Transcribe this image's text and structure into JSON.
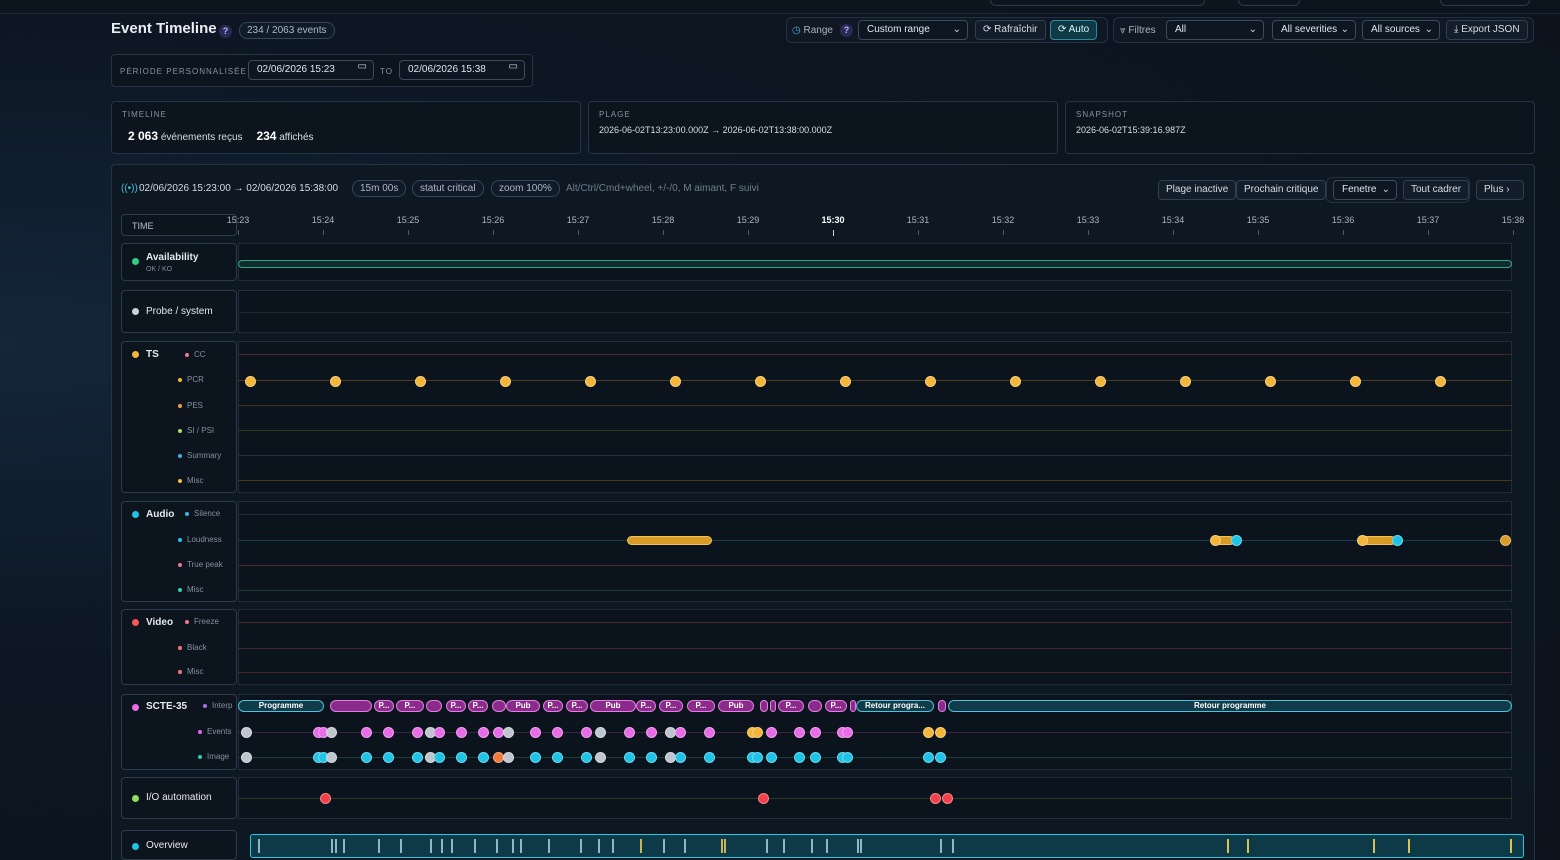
{
  "header": {
    "title": "Event Timeline",
    "help": "?",
    "count_chip": "234 / 2063 events"
  },
  "controls": {
    "range_label": "Range",
    "range_help": "?",
    "range_value": "Custom range",
    "refresh_label": "Rafraîchir",
    "auto_label": "Auto",
    "filters_label": "Filtres",
    "filter_type": "All",
    "severities": "All severities",
    "sources": "All sources",
    "export_label": "Export JSON"
  },
  "period": {
    "label": "PÉRIODE PERSONNALISÉE",
    "from": "02/06/2026 15:23",
    "to_label": "TO",
    "to": "02/06/2026 15:38"
  },
  "stats": {
    "timeline_header": "TIMELINE",
    "received_count": "2 063",
    "received_label": "événements reçus",
    "shown_count": "234",
    "shown_label": "affichés",
    "plage_header": "PLAGE",
    "plage_value": "2026-06-02T13:23:00.000Z → 2026-06-02T13:38:00.000Z",
    "snapshot_header": "SNAPSHOT",
    "snapshot_value": "2026-06-02T15:39:16.987Z"
  },
  "toolbar": {
    "live_icon": "broadcast-icon",
    "range_text": "02/06/2026 15:23:00 → 02/06/2026 15:38:00",
    "duration_chip": "15m 00s",
    "status_chip": "statut critical",
    "zoom_chip": "zoom 100%",
    "hint": "Alt/Ctrl/Cmd+wheel, +/-/0, M aimant, F suivi",
    "inactive_btn": "Plage inactive",
    "next_critical_btn": "Prochain critique",
    "window_select": "Fenetre",
    "fit_btn": "Tout cadrer",
    "more_btn": "Plus"
  },
  "axis": {
    "time_label": "TIME",
    "ticks": [
      "15:23",
      "15:24",
      "15:25",
      "15:26",
      "15:27",
      "15:28",
      "15:29",
      "15:30",
      "15:31",
      "15:32",
      "15:33",
      "15:34",
      "15:35",
      "15:36",
      "15:37",
      "15:38"
    ],
    "bold_tick": "15:30"
  },
  "tracks": {
    "availability": {
      "name": "Availability",
      "sub": "OK / KO",
      "color": "#2fd083"
    },
    "probe": {
      "name": "Probe / system",
      "color": "#c9d1da"
    },
    "ts": {
      "name": "TS",
      "color": "#f4b63a",
      "subs": [
        "CC",
        "PCR",
        "PES",
        "SI / PSI",
        "Summary",
        "Misc"
      ]
    },
    "audio": {
      "name": "Audio",
      "color": "#1fc3e6",
      "subs": [
        "Silence",
        "Loudness",
        "True peak",
        "Misc"
      ]
    },
    "video": {
      "name": "Video",
      "color": "#f2575d",
      "subs": [
        "Freeze",
        "Black",
        "Misc"
      ]
    },
    "scte": {
      "name": "SCTE-35",
      "color": "#e86be8",
      "subs": [
        "Interp",
        "Events",
        "Image"
      ]
    },
    "io": {
      "name": "I/O automation",
      "color": "#8fe05a"
    },
    "overview": {
      "name": "Overview",
      "color": "#1fc3e6"
    }
  },
  "scte_segments": [
    {
      "label": "Programme",
      "kind": "prog"
    },
    {
      "label": "Pub",
      "kind": "pub"
    },
    {
      "label": "P...",
      "kind": "pub"
    },
    {
      "label": "Pub",
      "kind": "pub"
    },
    {
      "label": "Pub",
      "kind": "pub"
    },
    {
      "label": "P...",
      "kind": "pub"
    },
    {
      "label": "P...",
      "kind": "pub"
    },
    {
      "label": "Pub",
      "kind": "pub"
    },
    {
      "label": "P...",
      "kind": "pub"
    },
    {
      "label": "P...",
      "kind": "pub"
    },
    {
      "label": "Retour progra...",
      "kind": "prog"
    },
    {
      "label": "Retour programme",
      "kind": "prog"
    }
  ]
}
